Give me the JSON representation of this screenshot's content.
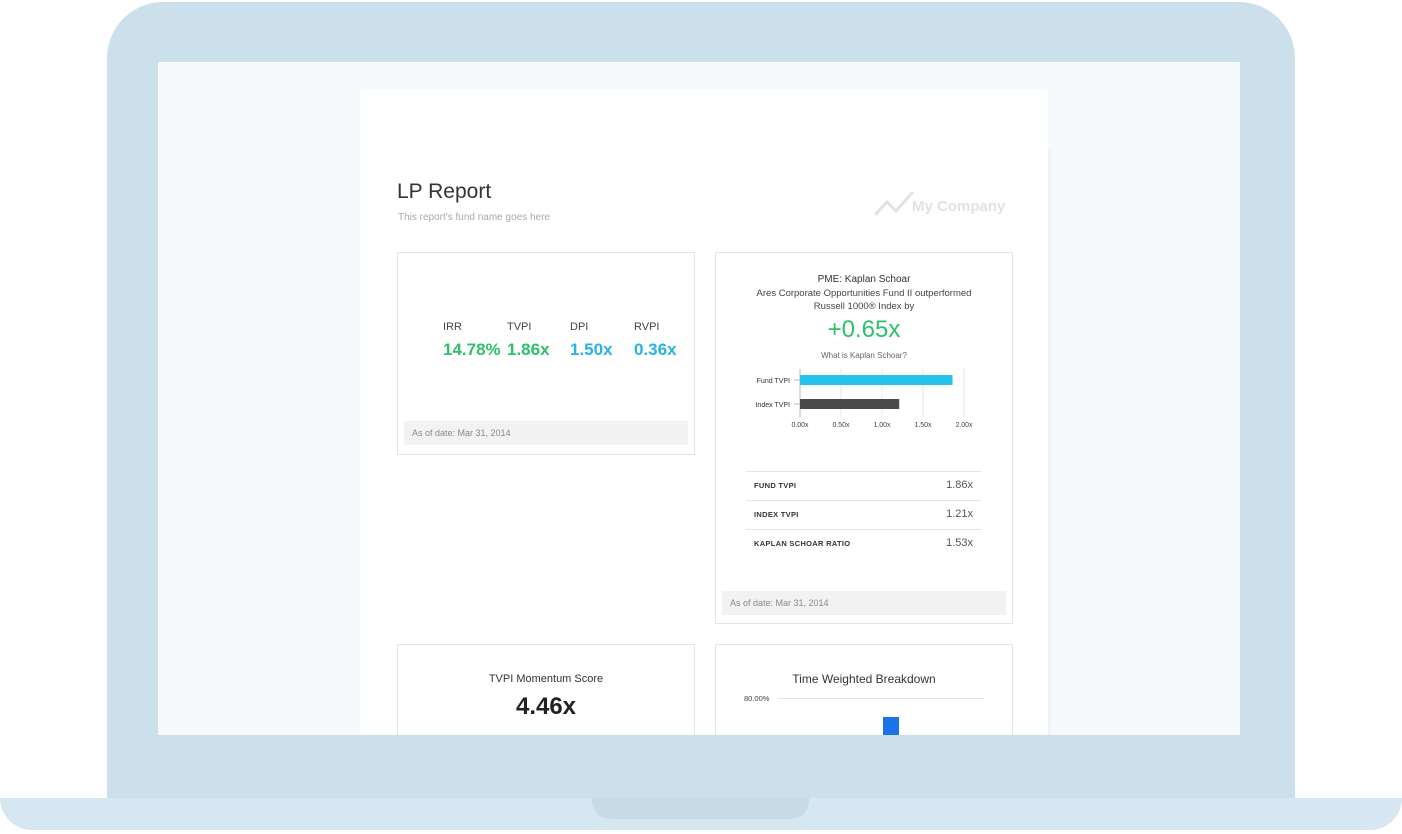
{
  "report": {
    "title": "LP Report",
    "subtitle": "This report's fund name goes here",
    "logo_text": "My Company"
  },
  "performance": {
    "metrics": [
      {
        "label": "IRR",
        "value": "14.78%",
        "color": "#2ec06a"
      },
      {
        "label": "TVPI",
        "value": "1.86x",
        "color": "#2ec06a"
      },
      {
        "label": "DPI",
        "value": "1.50x",
        "color": "#27b3e3"
      },
      {
        "label": "RVPI",
        "value": "0.36x",
        "color": "#27b3e3"
      }
    ],
    "as_of": "As of date: Mar 31, 2014"
  },
  "pme": {
    "title": "PME: Kaplan Schoar",
    "line1": "Ares Corporate Opportunities Fund II outperformed",
    "line2": "Russell 1000® Index by",
    "value": "+0.65x",
    "link": "What is Kaplan Schoar?",
    "table": [
      {
        "label": "FUND TVPI",
        "value": "1.86x"
      },
      {
        "label": "INDEX TVPI",
        "value": "1.21x"
      },
      {
        "label": "KAPLAN SCHOAR RATIO",
        "value": "1.53x"
      }
    ],
    "as_of": "As of date: Mar 31, 2014"
  },
  "momentum": {
    "title": "TVPI Momentum Score",
    "value": "4.46x"
  },
  "time_weighted": {
    "title": "Time Weighted Breakdown",
    "axis_top_label": "80.00%"
  },
  "colors": {
    "fund_bar": "#27c2ea",
    "index_bar": "#4b4b4b",
    "positive": "#2ec06a",
    "accent_cyan": "#27b3e3",
    "breakdown_bar": "#1a73e8"
  },
  "chart_data": [
    {
      "type": "bar",
      "orientation": "horizontal",
      "categories": [
        "Fund TVPI",
        "Index TVPI"
      ],
      "values": [
        1.86,
        1.21
      ],
      "xlim": [
        0,
        2.0
      ],
      "x_ticks": [
        "0.00x",
        "0.50x",
        "1.00x",
        "1.50x",
        "2.00x"
      ],
      "grid": true
    }
  ]
}
